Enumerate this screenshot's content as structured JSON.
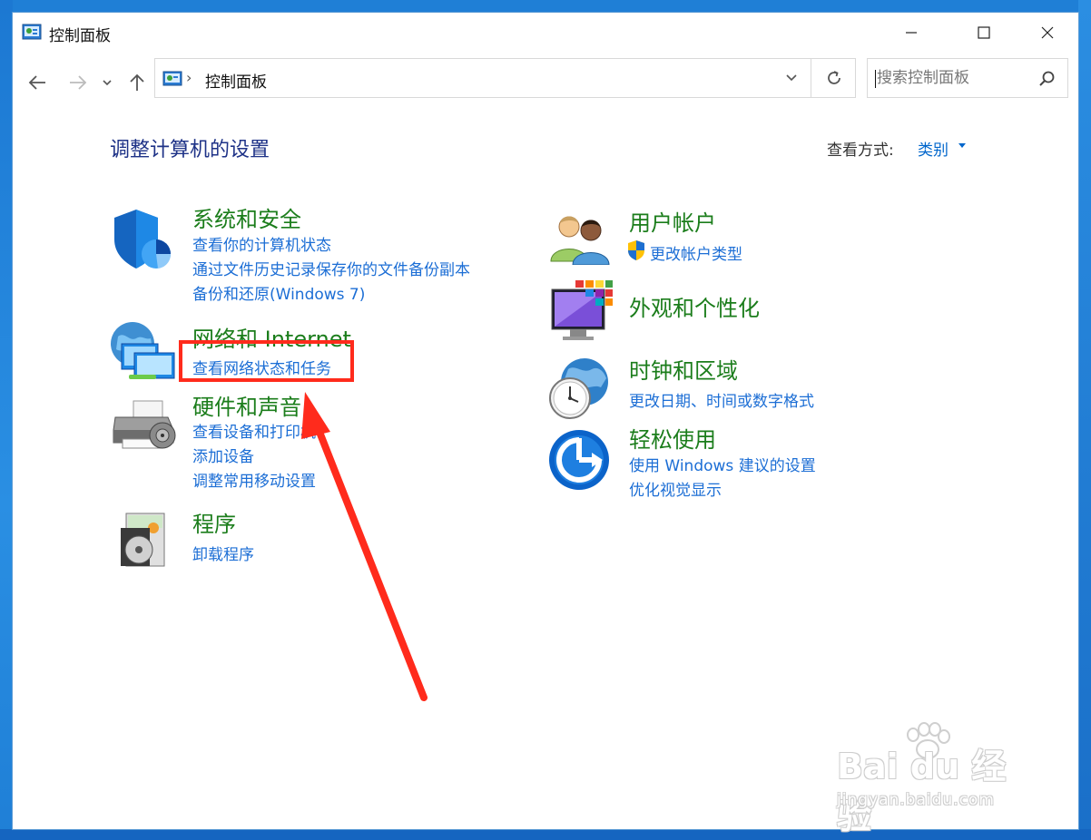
{
  "window": {
    "title": "控制面板",
    "controls": {
      "minimize": "minimize-icon",
      "maximize": "maximize-icon",
      "close": "close-icon"
    }
  },
  "nav": {
    "back": "back-arrow-icon",
    "forward": "forward-arrow-icon",
    "recent": "chevron-down-icon",
    "up": "up-arrow-icon"
  },
  "address": {
    "separator": "›",
    "path": "控制面板"
  },
  "search": {
    "placeholder": "搜索控制面板",
    "value": ""
  },
  "content": {
    "title": "调整计算机的设置",
    "view_by_label": "查看方式:",
    "view_by_value": "类别"
  },
  "categories": [
    {
      "title": "系统和安全",
      "icon": "shield-icon",
      "links": [
        "查看你的计算机状态",
        "通过文件历史记录保存你的文件备份副本",
        "备份和还原(Windows 7)"
      ]
    },
    {
      "title": "网络和 Internet",
      "icon": "network-globe-icon",
      "links": [
        "查看网络状态和任务"
      ]
    },
    {
      "title": "硬件和声音",
      "icon": "printer-icon",
      "links": [
        "查看设备和打印机",
        "添加设备",
        "调整常用移动设置"
      ]
    },
    {
      "title": "程序",
      "icon": "programs-disc-icon",
      "links": [
        "卸载程序"
      ]
    },
    {
      "title": "用户帐户",
      "icon": "users-icon",
      "links": [
        "更改帐户类型"
      ]
    },
    {
      "title": "外观和个性化",
      "icon": "monitor-palette-icon",
      "links": []
    },
    {
      "title": "时钟和区域",
      "icon": "clock-globe-icon",
      "links": [
        "更改日期、时间或数字格式"
      ]
    },
    {
      "title": "轻松使用",
      "icon": "ease-of-access-icon",
      "links": [
        "使用 Windows 建议的设置",
        "优化视觉显示"
      ]
    }
  ],
  "colors": {
    "category_title": "#1b7d1b",
    "link": "#1c6ed5",
    "page_title": "#1e3287",
    "annotation": "#ff2b1c"
  },
  "watermark": {
    "brand": "Bai du 经验",
    "url": "jingyan.baidu.com"
  }
}
